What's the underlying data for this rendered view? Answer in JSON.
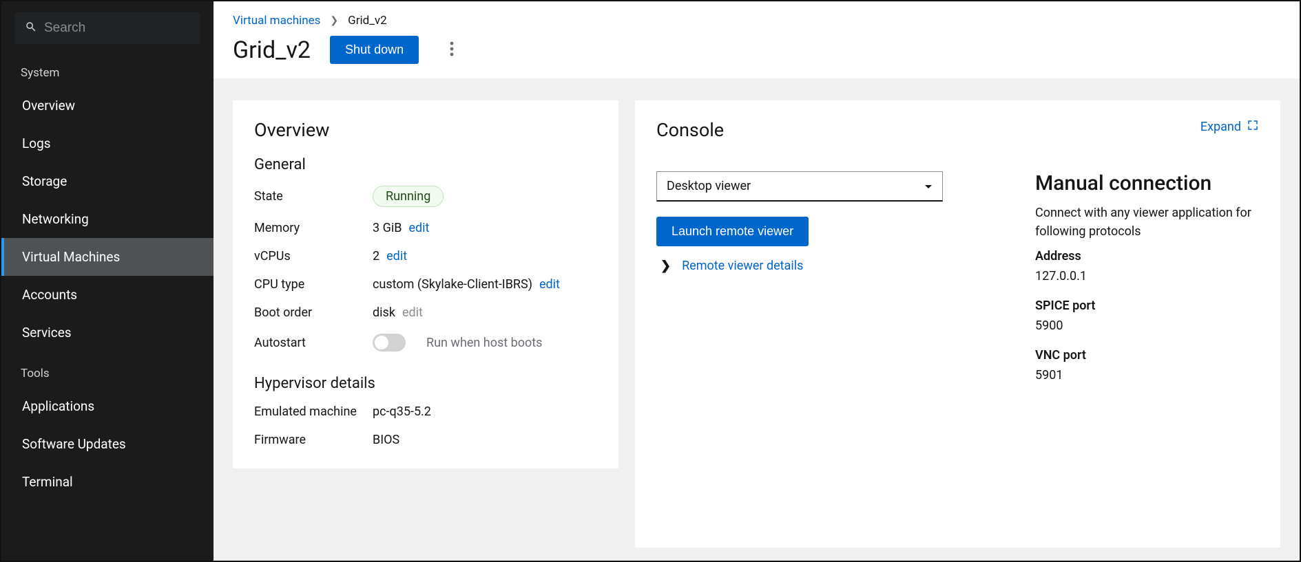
{
  "sidebar": {
    "search_placeholder": "Search",
    "sections": {
      "system": {
        "title": "System",
        "items": [
          "Overview",
          "Logs",
          "Storage",
          "Networking",
          "Virtual Machines",
          "Accounts",
          "Services"
        ]
      },
      "tools": {
        "title": "Tools",
        "items": [
          "Applications",
          "Software Updates",
          "Terminal"
        ]
      }
    },
    "active_item": "Virtual Machines"
  },
  "breadcrumb": {
    "parent": "Virtual machines",
    "current": "Grid_v2"
  },
  "page": {
    "title": "Grid_v2",
    "shutdown_label": "Shut down"
  },
  "overview": {
    "title": "Overview",
    "general_title": "General",
    "state_label": "State",
    "state_value": "Running",
    "memory_label": "Memory",
    "memory_value": "3 GiB",
    "vcpus_label": "vCPUs",
    "vcpus_value": "2",
    "cpu_type_label": "CPU type",
    "cpu_type_value": "custom (Skylake-Client-IBRS)",
    "boot_order_label": "Boot order",
    "boot_order_value": "disk",
    "autostart_label": "Autostart",
    "autostart_desc": "Run when host boots",
    "edit": "edit",
    "hypervisor_title": "Hypervisor details",
    "emulated_machine_label": "Emulated machine",
    "emulated_machine_value": "pc-q35-5.2",
    "firmware_label": "Firmware",
    "firmware_value": "BIOS"
  },
  "console": {
    "title": "Console",
    "expand": "Expand",
    "viewer_select": "Desktop viewer",
    "launch_label": "Launch remote viewer",
    "remote_details": "Remote viewer details",
    "manual_title": "Manual connection",
    "manual_desc": "Connect with any viewer application for following protocols",
    "address_label": "Address",
    "address_value": "127.0.0.1",
    "spice_label": "SPICE port",
    "spice_value": "5900",
    "vnc_label": "VNC port",
    "vnc_value": "5901"
  }
}
